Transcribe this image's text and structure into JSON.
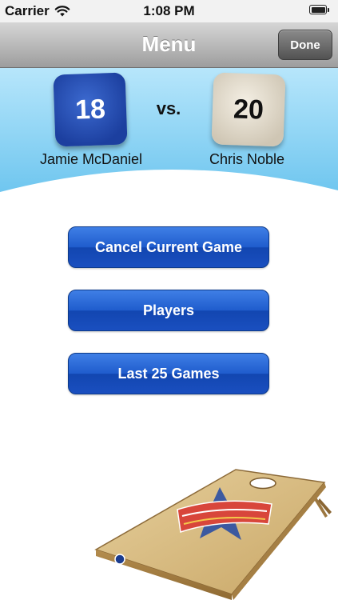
{
  "status_bar": {
    "carrier": "Carrier",
    "time": "1:08 PM",
    "icons": [
      "wifi-icon",
      "battery-icon"
    ]
  },
  "nav": {
    "title": "Menu",
    "done_label": "Done"
  },
  "score": {
    "player1": {
      "name": "Jamie McDaniel",
      "score": "18",
      "bag_color": "#1f47b5"
    },
    "player2": {
      "name": "Chris Noble",
      "score": "20",
      "bag_color": "#e6dfd0"
    },
    "vs_label": "vs."
  },
  "menu": {
    "buttons": [
      {
        "label": "Cancel Current Game"
      },
      {
        "label": "Players"
      },
      {
        "label": "Last 25 Games"
      }
    ]
  },
  "colors": {
    "header_sky": "#8fd4f5",
    "button_blue": "#1f5ccd",
    "nav_gray": "#b4b4b4"
  }
}
